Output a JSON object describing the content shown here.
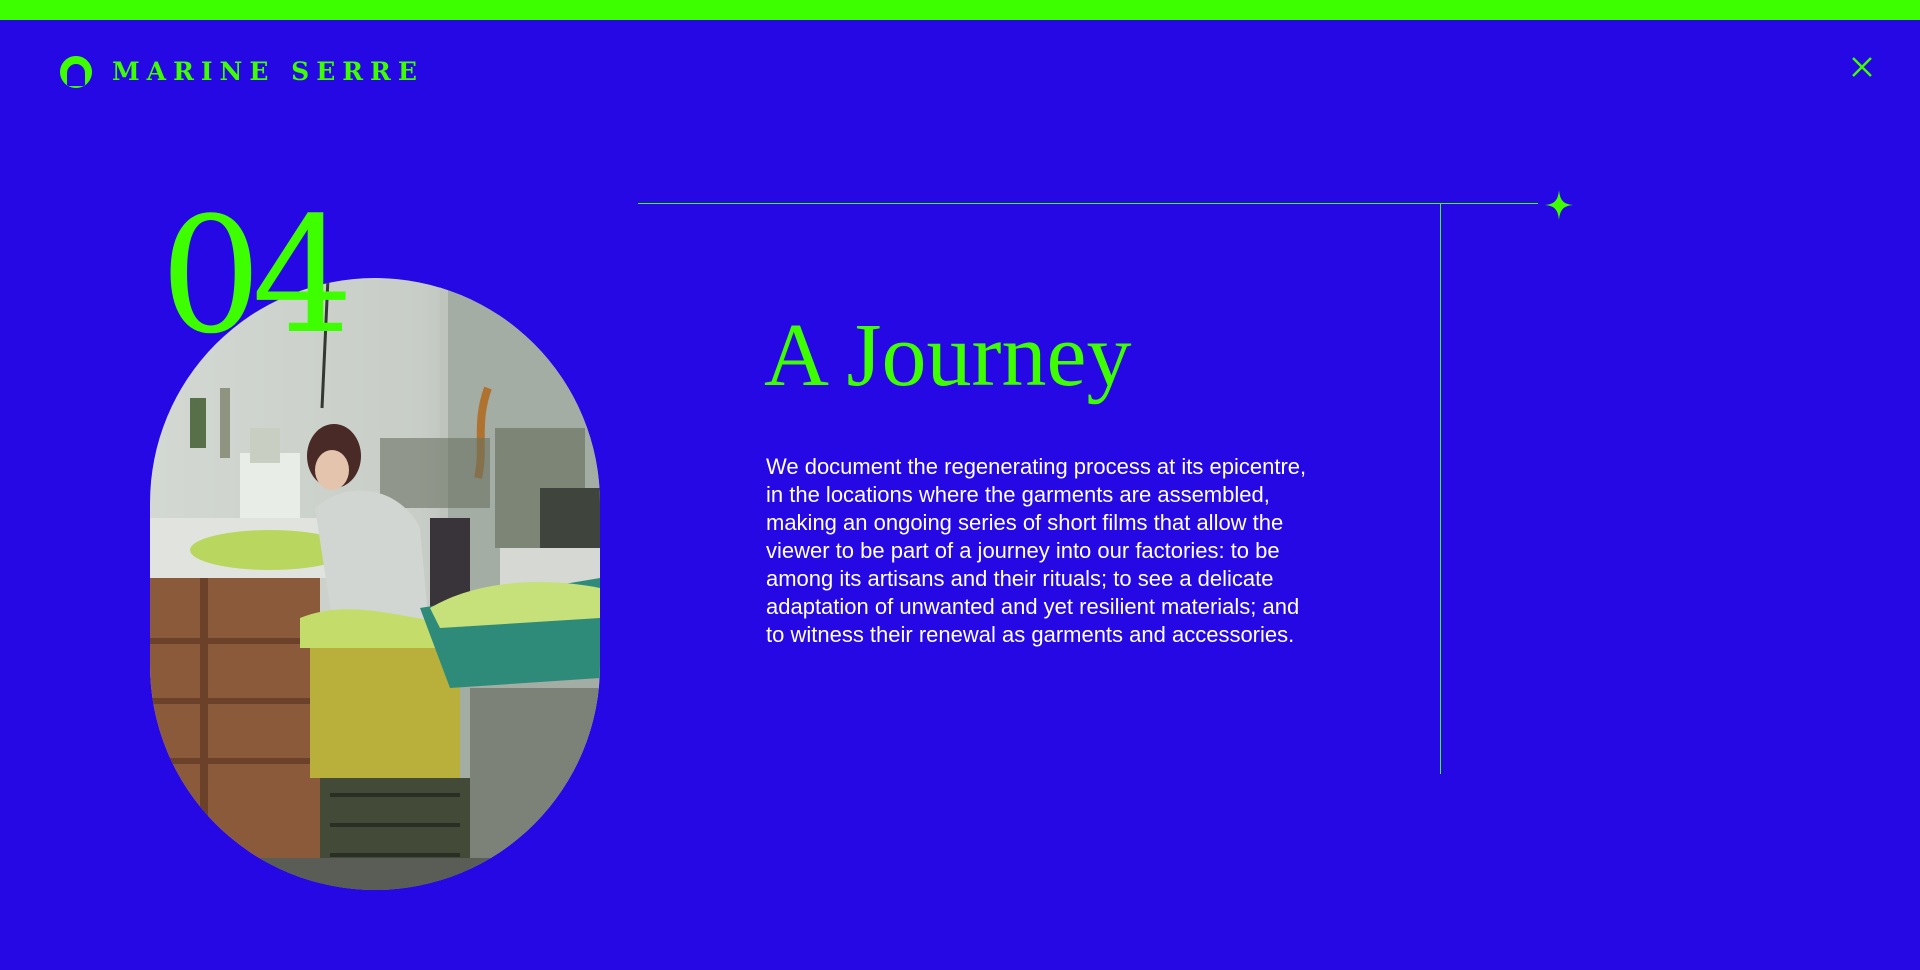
{
  "brand": {
    "name": "MARINE SERRE",
    "logo_icon": "crescent-moon-icon"
  },
  "header": {
    "close_icon": "close-icon"
  },
  "colors": {
    "background": "#2508e4",
    "accent": "#3dff00",
    "body_text": "#ffffff"
  },
  "section": {
    "number": "04",
    "title": "A Journey",
    "body": "We document the regenerating process at its epicentre,\nin the locations where the garments are assembled,\nmaking an ongoing series of short films that allow the\n viewer to be part of a journey into our factories: to be\namong its artisans and their rituals; to see a delicate\nadaptation of unwanted and yet resilient materials; and\nto witness their renewal as garments and accessories.",
    "decor_icon": "four-point-star-icon"
  }
}
